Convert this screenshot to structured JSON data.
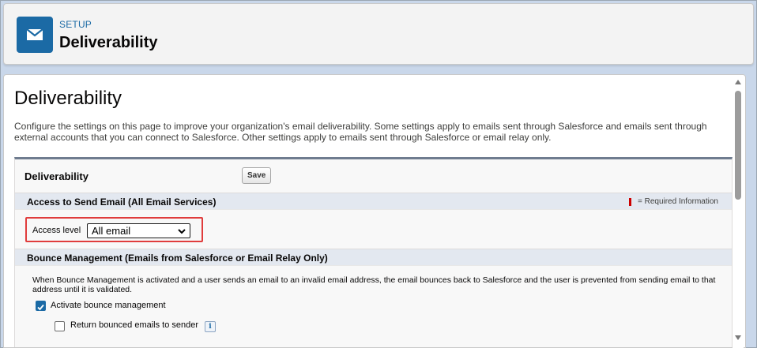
{
  "header": {
    "eyebrow": "SETUP",
    "title": "Deliverability",
    "icon": "email-icon"
  },
  "page": {
    "title": "Deliverability",
    "description": "Configure the settings on this page to improve your organization's email deliverability. Some settings apply to emails sent through Salesforce and emails sent through external accounts that you can connect to Salesforce. Other settings apply to emails sent through Salesforce or email relay only."
  },
  "block": {
    "title": "Deliverability",
    "save_label": "Save"
  },
  "access_section": {
    "title": "Access to Send Email (All Email Services)",
    "required_note": "= Required Information",
    "access_label": "Access level",
    "access_value": "All email"
  },
  "bounce_section": {
    "title": "Bounce Management (Emails from Salesforce or Email Relay Only)",
    "description": "When Bounce Management is activated and a user sends an email to an invalid email address, the email bounces back to Salesforce and the user is prevented from sending email to that address until it is validated.",
    "activate_label": "Activate bounce management",
    "activate_checked": true,
    "return_label": "Return bounced emails to sender",
    "return_checked": false,
    "info_icon": "info-icon"
  },
  "colors": {
    "brand": "#1b6aa5",
    "highlight": "#e03c3c",
    "required": "#cc0000"
  }
}
